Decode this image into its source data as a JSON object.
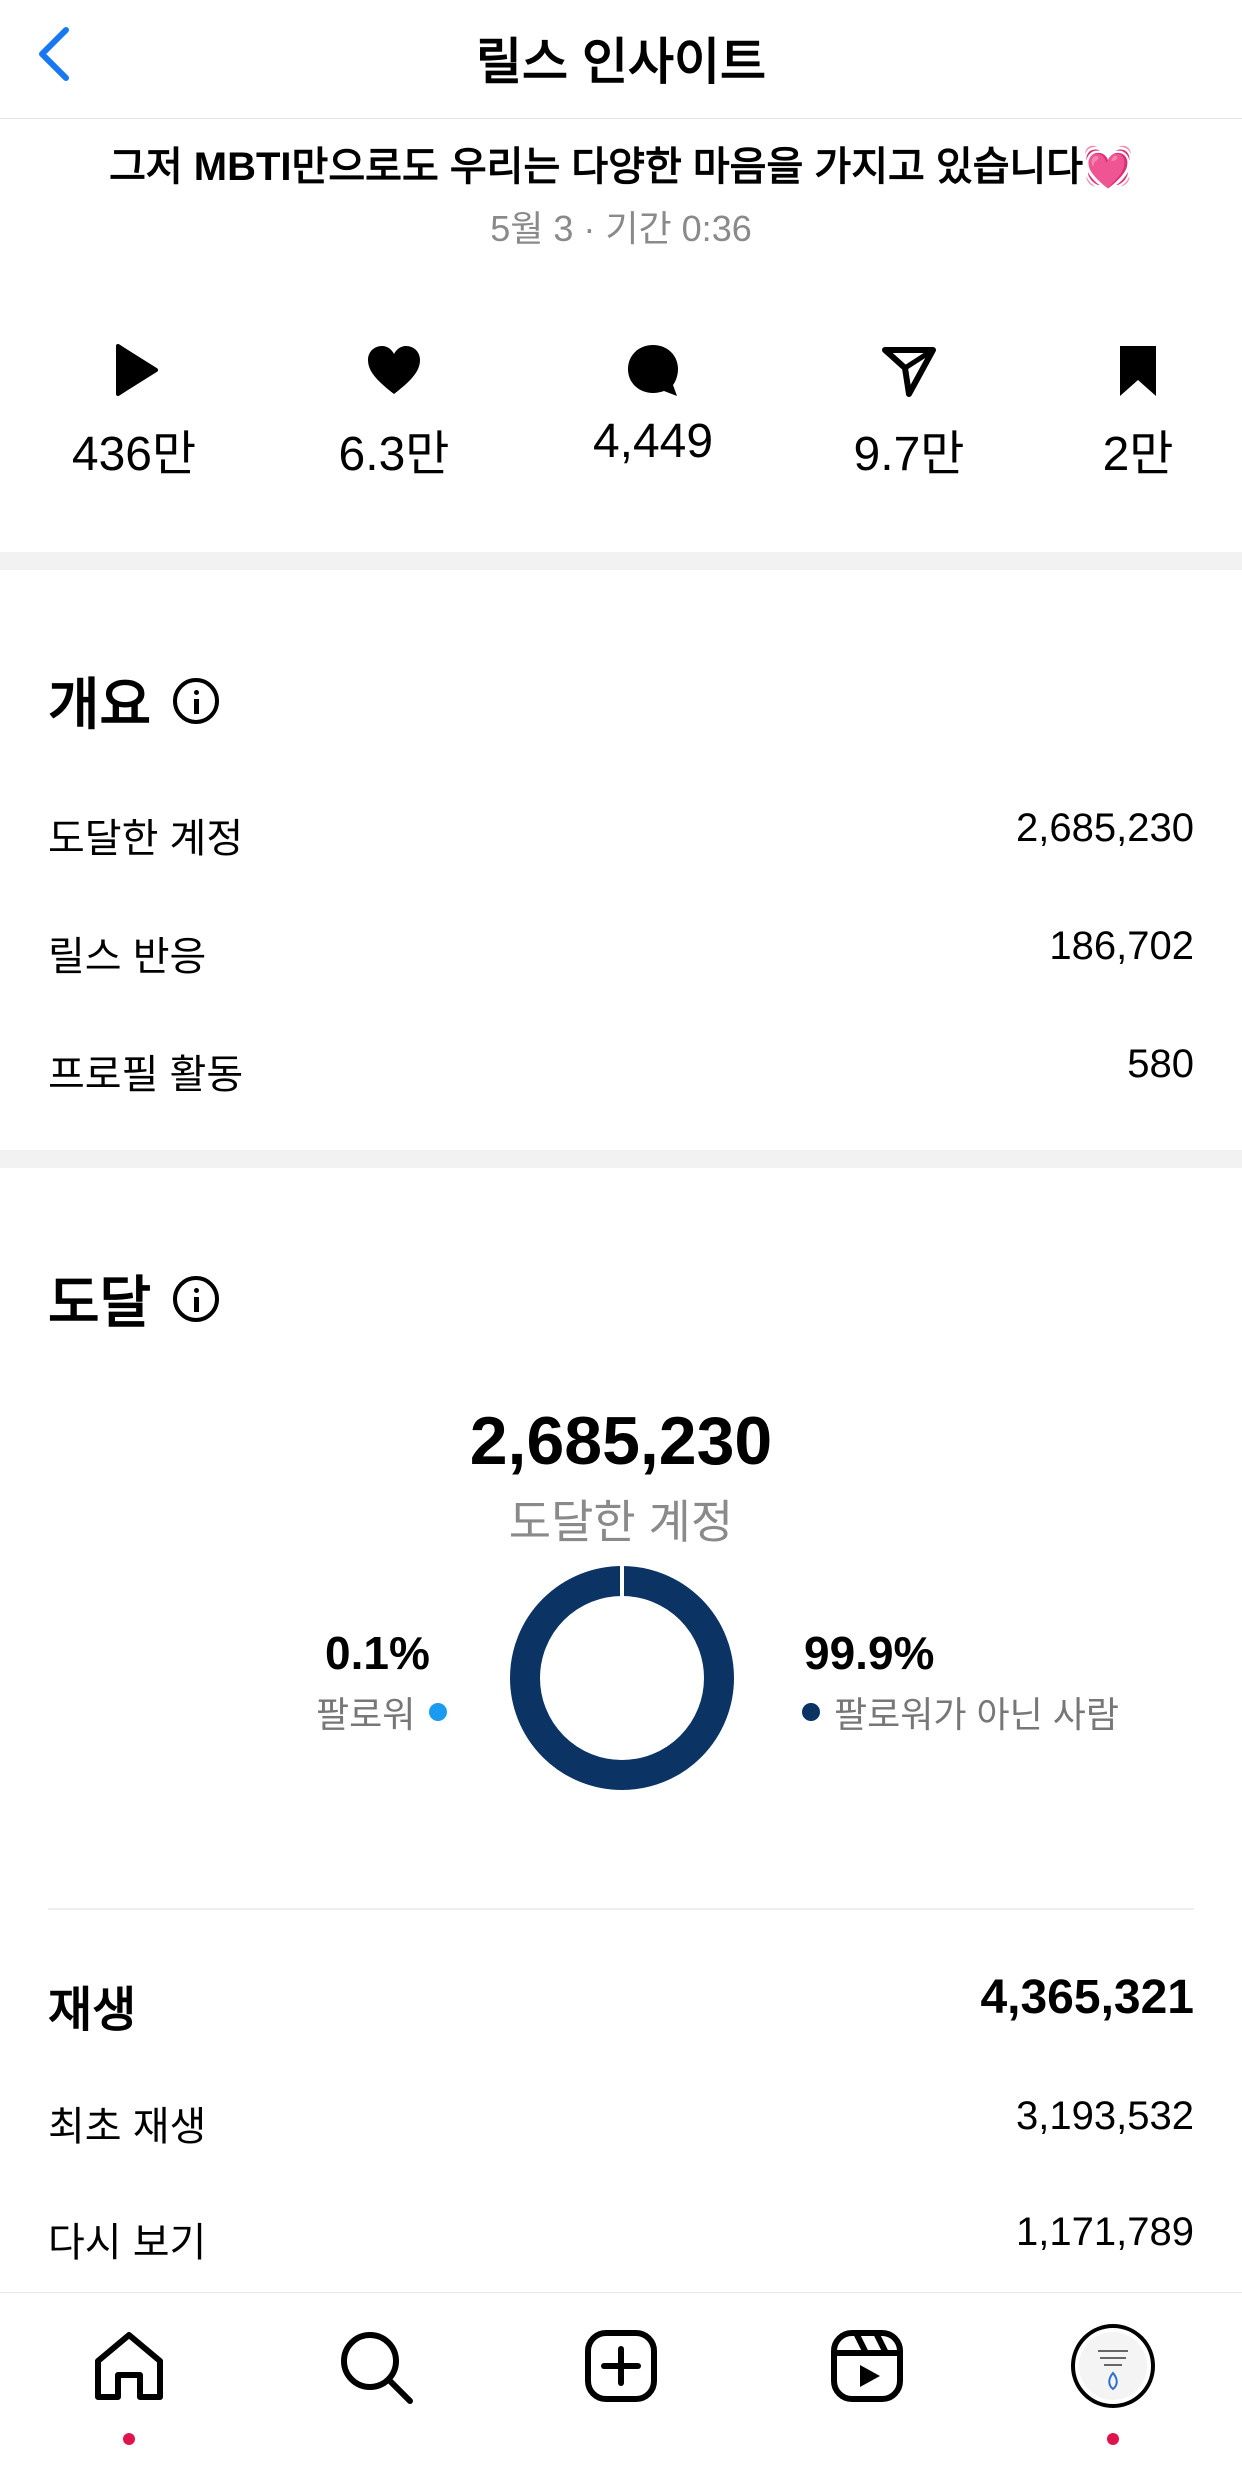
{
  "header": {
    "title": "릴스 인사이트"
  },
  "post": {
    "caption": "그저 MBTI만으로도 우리는 다양한 마음을 가지고 있습니다💓",
    "meta": "5월 3 · 기간 0:36"
  },
  "stats": [
    {
      "icon": "play-icon",
      "value": "436만"
    },
    {
      "icon": "heart-icon",
      "value": "6.3만"
    },
    {
      "icon": "comment-icon",
      "value": "4,449"
    },
    {
      "icon": "share-icon",
      "value": "9.7만"
    },
    {
      "icon": "bookmark-icon",
      "value": "2만"
    }
  ],
  "overview": {
    "title": "개요",
    "rows": [
      {
        "label": "도달한 계정",
        "value": "2,685,230"
      },
      {
        "label": "릴스 반응",
        "value": "186,702"
      },
      {
        "label": "프로필 활동",
        "value": "580"
      }
    ]
  },
  "reach": {
    "title": "도달",
    "total": "2,685,230",
    "total_label": "도달한 계정",
    "followers_pct": "0.1%",
    "followers_label": "팔로워",
    "nonfollowers_pct": "99.9%",
    "nonfollowers_label": "팔로워가 아닌 사람",
    "followers_fraction": 0.001,
    "colors": {
      "followers": "#1a9bf0",
      "nonfollowers": "#0b3363"
    }
  },
  "plays": {
    "title": "재생",
    "total": "4,365,321",
    "rows": [
      {
        "label": "최초 재생",
        "value": "3,193,532"
      },
      {
        "label": "다시 보기",
        "value": "1,171,789"
      }
    ]
  },
  "nav": {
    "items": [
      "home-icon",
      "search-icon",
      "create-icon",
      "reels-icon",
      "profile-avatar"
    ],
    "accent": "#e0144c"
  }
}
